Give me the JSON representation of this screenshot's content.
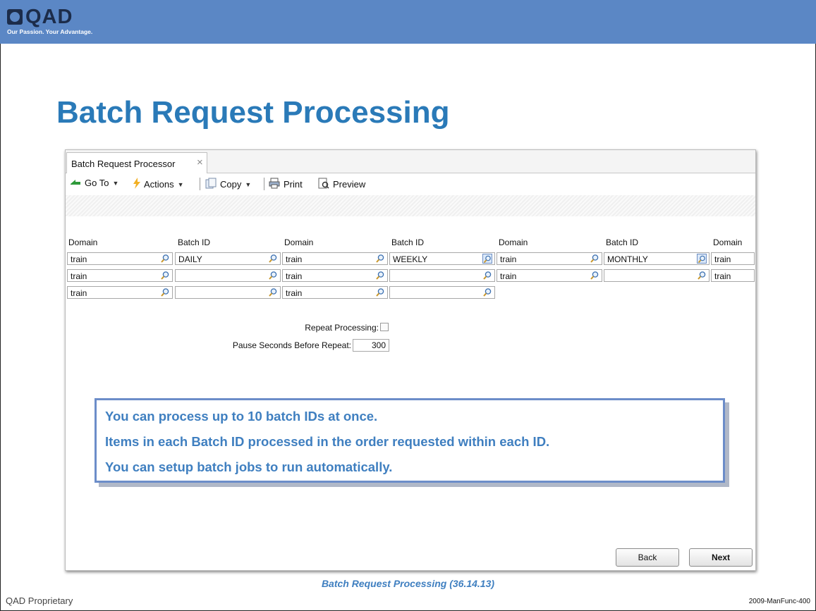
{
  "slide": {
    "logo_text": "QAD",
    "tagline": "Our Passion. Your Advantage.",
    "title": "Batch Request Processing",
    "caption": "Batch Request Processing (36.14.13)",
    "footer_left": "QAD Proprietary",
    "footer_right": "2009-ManFunc-400"
  },
  "tab": {
    "label": "Batch Request Processor",
    "close": "×"
  },
  "toolbar": {
    "goto_label": "Go To",
    "actions_label": "Actions",
    "copy_label": "Copy",
    "print_label": "Print",
    "preview_label": "Preview"
  },
  "columns": [
    "Domain",
    "Batch ID",
    "Domain",
    "Batch ID",
    "Domain",
    "Batch ID",
    "Domain"
  ],
  "rows": [
    [
      "train",
      "DAILY",
      "train",
      "WEEKLY",
      "train",
      "MONTHLY",
      "train"
    ],
    [
      "train",
      "",
      "train",
      "",
      "train",
      "",
      "train"
    ],
    [
      "train",
      "",
      "train",
      ""
    ]
  ],
  "options": {
    "repeat_label": "Repeat Processing:",
    "repeat_checked": false,
    "pause_label": "Pause Seconds Before Repeat:",
    "pause_value": "300"
  },
  "callout": {
    "lines": [
      "You can process up to 10 batch IDs at once.",
      "Items in each Batch ID processed in the order requested within each ID.",
      "You can setup batch jobs to run automatically."
    ]
  },
  "buttons": {
    "back": "Back",
    "next": "Next"
  }
}
